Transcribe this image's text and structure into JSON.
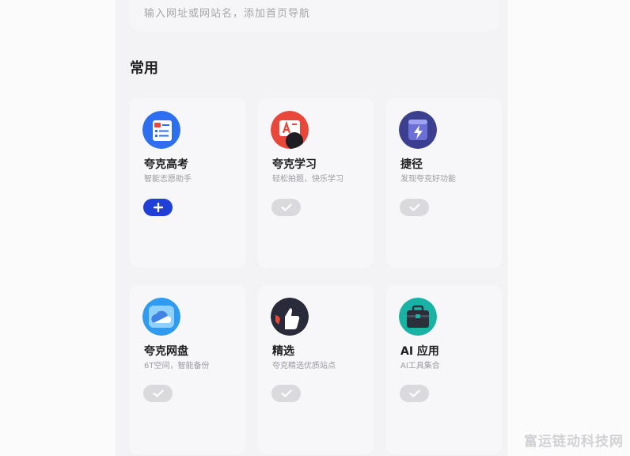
{
  "search": {
    "placeholder": "输入网址或网站名，添加首页导航"
  },
  "section": {
    "title": "常用"
  },
  "cards": [
    {
      "title": "夸克高考",
      "subtitle": "智能志愿助手",
      "state": "add",
      "icon": "exam-icon",
      "color": "#2e6ef0"
    },
    {
      "title": "夸克学习",
      "subtitle": "轻松拍题，快乐学习",
      "state": "added",
      "icon": "study-icon",
      "color": "#e9473a"
    },
    {
      "title": "捷径",
      "subtitle": "发现夸克好功能",
      "state": "added",
      "icon": "shortcut-icon",
      "color": "#3c3f8f"
    },
    {
      "title": "夸克网盘",
      "subtitle": "6T空间，智能备份",
      "state": "added",
      "icon": "cloud-drive-icon",
      "color": "#2e9bf0"
    },
    {
      "title": "精选",
      "subtitle": "夸克精选优质站点",
      "state": "added",
      "icon": "featured-icon",
      "color": "#2a2b3a"
    },
    {
      "title": "AI 应用",
      "subtitle": "AI工具集合",
      "state": "added",
      "icon": "ai-app-icon",
      "color": "#19b3a6"
    }
  ],
  "watermark": "富运链动科技网"
}
